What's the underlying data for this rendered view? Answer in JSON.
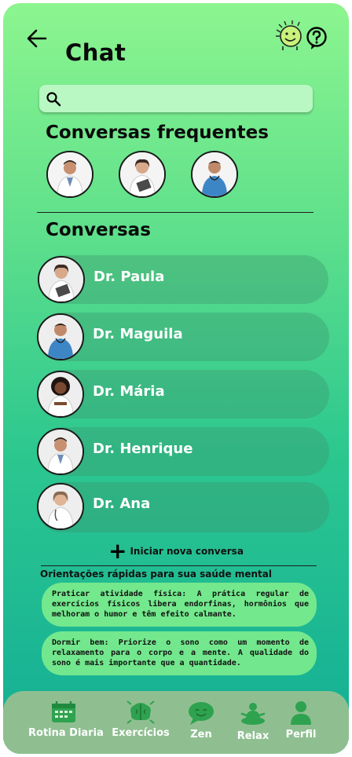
{
  "header": {
    "title": "Chat",
    "back_icon": "arrow-left-icon",
    "mascot_icon": "happy-sun-mascot-icon",
    "help_icon": "help-question-icon"
  },
  "search": {
    "placeholder": "",
    "value": ""
  },
  "frequent": {
    "title": "Conversas frequentes"
  },
  "conversations": {
    "title": "Conversas",
    "items": [
      {
        "name": "Dr. Paula"
      },
      {
        "name": "Dr. Maguila"
      },
      {
        "name": "Dr. Mária"
      },
      {
        "name": "Dr. Henrique"
      },
      {
        "name": "Dr. Ana"
      }
    ]
  },
  "new_conversation": {
    "label": "Iniciar nova conversa"
  },
  "tips": {
    "title": "Orientações rápidas para sua saúde mental",
    "items": [
      {
        "text": "Praticar atividade física: A prática regular de exercícios físicos libera endorfinas, hormônios que melhoram o humor e têm efeito calmante."
      },
      {
        "text": "Dormir bem: Priorize o sono como um momento de relaxamento para o corpo e a mente. A qualidade do sono é mais importante que a quantidade."
      }
    ]
  },
  "tabbar": {
    "items": [
      {
        "label": "Rotina Diaria",
        "icon": "calendar-icon"
      },
      {
        "label": "Exercícios",
        "icon": "brain-icon"
      },
      {
        "label": "Zen",
        "icon": "chat-bubble-icon"
      },
      {
        "label": "Relax",
        "icon": "meditation-icon"
      },
      {
        "label": "Perfil",
        "icon": "person-icon"
      }
    ]
  },
  "colors": {
    "gradient_top": "#8cf58f",
    "gradient_bottom": "#12ae96",
    "tab_bar": "#8fbf91",
    "search_bg": "#b9f7c3"
  }
}
